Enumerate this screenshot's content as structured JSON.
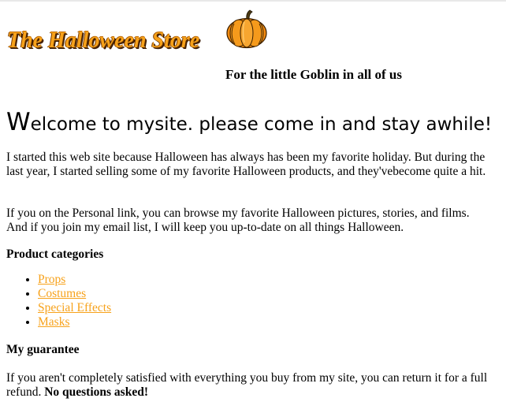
{
  "header": {
    "logo_text": "The Halloween Store",
    "logo_icon": "pumpkin-icon",
    "tagline": "For the little Goblin in all of us"
  },
  "welcome": {
    "first_letter": "W",
    "rest": "elcome to mysite. please come in and stay awhile!"
  },
  "intro": {
    "paragraph1": "I started this web site because Halloween has always has been my favorite holiday. But during the last year, I started selling some of my favorite Halloween products, and they'vebecome quite a hit.",
    "paragraph2": "If you on the Personal link, you can browse my favorite Halloween pictures, stories, and films. And if you join my email list, I will keep you up-to-date on all things Halloween."
  },
  "products": {
    "heading": "Product categories",
    "items": [
      {
        "label": "Props"
      },
      {
        "label": "Costumes"
      },
      {
        "label": "Special Effects"
      },
      {
        "label": "Masks"
      }
    ]
  },
  "guarantee": {
    "heading": "My guarantee",
    "text": "If you aren't completely satisfied with everything you buy from my site, you can return it for a full refund. ",
    "emphasis": "No questions asked!"
  },
  "colors": {
    "link": "#f7a21b",
    "logo_orange": "#f7a21b",
    "pumpkin_orange": "#f28a0f",
    "text": "#000000"
  }
}
